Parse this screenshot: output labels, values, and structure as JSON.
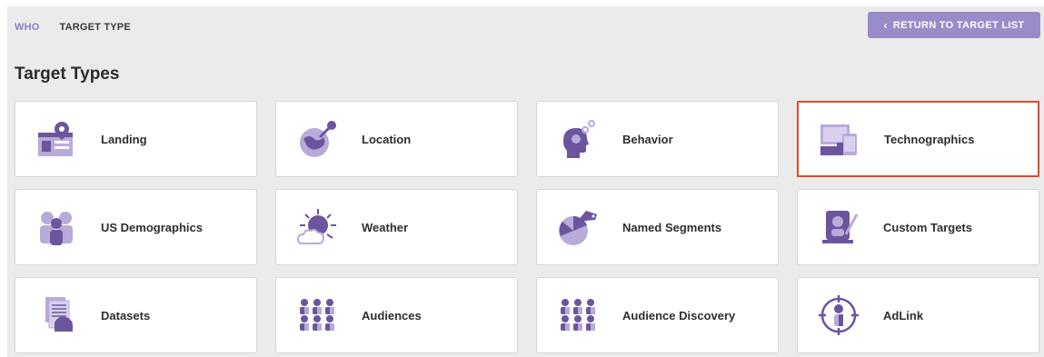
{
  "breadcrumb": {
    "who": "WHO",
    "current": "TARGET TYPE"
  },
  "header": {
    "return_button": "RETURN TO TARGET LIST",
    "title": "Target Types"
  },
  "cards": [
    {
      "label": "Landing",
      "icon": "landing-page-icon"
    },
    {
      "label": "Location",
      "icon": "location-globe-icon"
    },
    {
      "label": "Behavior",
      "icon": "behavior-head-icon"
    },
    {
      "label": "Technographics",
      "icon": "devices-icon",
      "selected": true
    },
    {
      "label": "US Demographics",
      "icon": "demographics-people-icon"
    },
    {
      "label": "Weather",
      "icon": "weather-sun-cloud-icon"
    },
    {
      "label": "Named Segments",
      "icon": "named-segments-pie-icon"
    },
    {
      "label": "Custom Targets",
      "icon": "custom-targets-icon"
    },
    {
      "label": "Datasets",
      "icon": "datasets-document-icon"
    },
    {
      "label": "Audiences",
      "icon": "audiences-icon"
    },
    {
      "label": "Audience Discovery",
      "icon": "audience-discovery-icon"
    },
    {
      "label": "AdLink",
      "icon": "adlink-icon"
    }
  ],
  "colors": {
    "accent": "#9a8bc9",
    "icon_dark": "#6b559f",
    "icon_light": "#b9abd9",
    "selected_border": "#e04a2a"
  }
}
